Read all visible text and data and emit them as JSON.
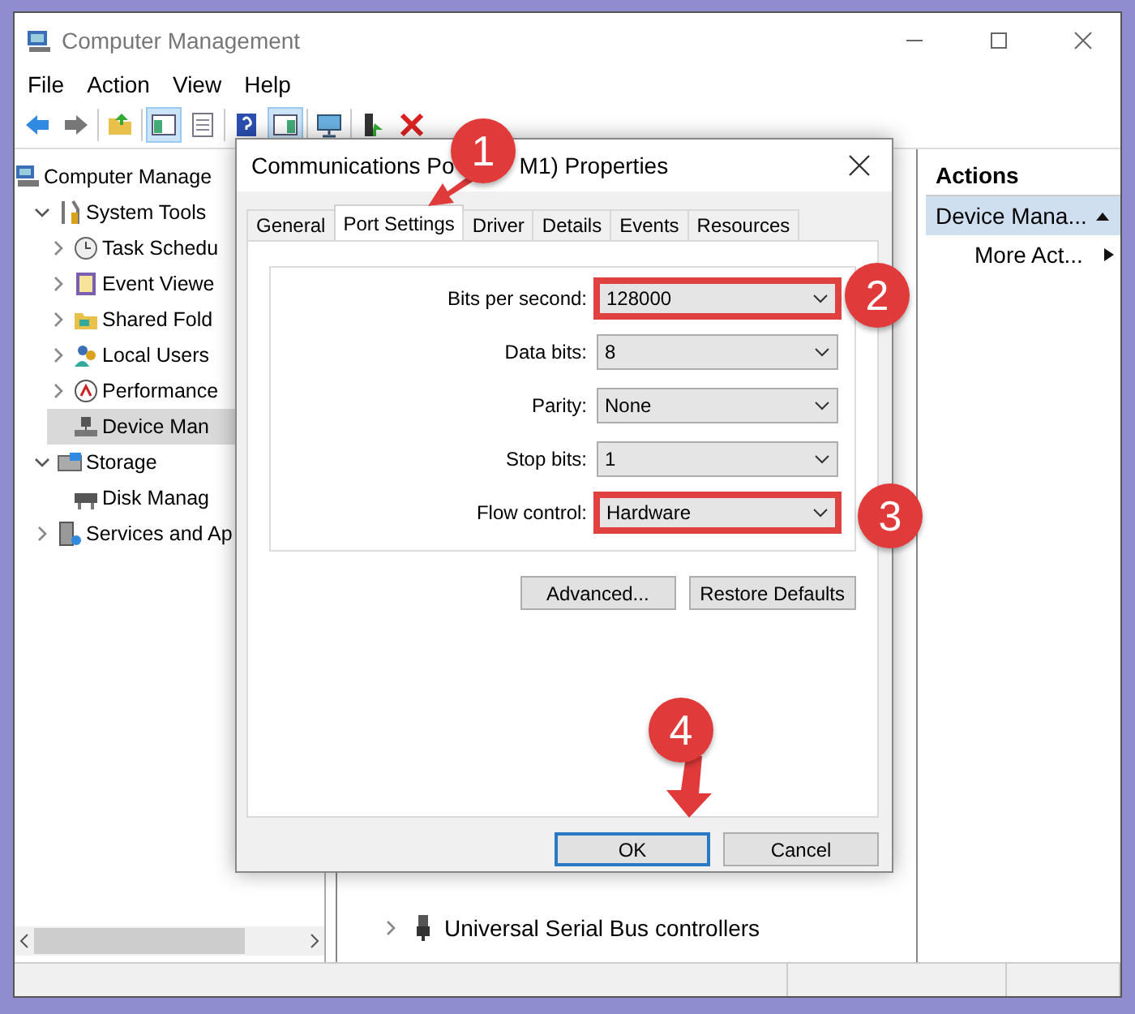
{
  "window": {
    "title": "Computer Management"
  },
  "menu": [
    "File",
    "Action",
    "View",
    "Help"
  ],
  "toolbar": [
    {
      "kind": "back",
      "pressed": false
    },
    {
      "kind": "forward",
      "pressed": false
    },
    {
      "kind": "folder",
      "pressed": false
    },
    {
      "kind": "pane",
      "pressed": true
    },
    {
      "kind": "list",
      "pressed": false
    },
    {
      "kind": "help",
      "pressed": false
    },
    {
      "kind": "pane2",
      "pressed": true
    },
    {
      "kind": "monitor",
      "pressed": false
    },
    {
      "kind": "user",
      "pressed": false
    },
    {
      "kind": "delete",
      "pressed": false
    }
  ],
  "tree": [
    {
      "label": "Computer Manage",
      "kind": "computer",
      "selected": false,
      "children": [
        {
          "label": "System Tools",
          "kind": "tools",
          "expanded": true,
          "selected": false,
          "children": [
            {
              "label": "Task Schedu",
              "kind": "clock",
              "expanded": false,
              "selected": false
            },
            {
              "label": "Event Viewe",
              "kind": "log",
              "expanded": false,
              "selected": false
            },
            {
              "label": "Shared Fold",
              "kind": "folder",
              "expanded": false,
              "selected": false
            },
            {
              "label": "Local Users",
              "kind": "users",
              "expanded": false,
              "selected": false
            },
            {
              "label": "Performance",
              "kind": "gauge",
              "expanded": false,
              "selected": false
            },
            {
              "label": "Device Man",
              "kind": "device",
              "selected": true
            }
          ]
        },
        {
          "label": "Storage",
          "kind": "storage",
          "expanded": true,
          "selected": false,
          "children": [
            {
              "label": "Disk Manag",
              "kind": "disk",
              "selected": false
            }
          ]
        },
        {
          "label": "Services and Ap",
          "kind": "services",
          "expanded": false,
          "selected": false
        }
      ]
    }
  ],
  "device_list": [
    {
      "label": "Universal Serial Bus controllers",
      "expanded": false
    }
  ],
  "actions": {
    "title": "Actions",
    "items": [
      {
        "label": "Device Mana...",
        "kind": "group"
      },
      {
        "label": "More Act...",
        "kind": "item"
      }
    ]
  },
  "dialog": {
    "title_parts": [
      "Communications Po",
      "M1) Properties"
    ],
    "tabs": [
      {
        "label": "General",
        "selected": false
      },
      {
        "label": "Port Settings",
        "selected": true
      },
      {
        "label": "Driver",
        "selected": false
      },
      {
        "label": "Details",
        "selected": false
      },
      {
        "label": "Events",
        "selected": false
      },
      {
        "label": "Resources",
        "selected": false
      }
    ],
    "fields": [
      {
        "label": "Bits per second:",
        "value": "128000",
        "highlighted": true
      },
      {
        "label": "Data bits:",
        "value": "8",
        "highlighted": false
      },
      {
        "label": "Parity:",
        "value": "None",
        "highlighted": false
      },
      {
        "label": "Stop bits:",
        "value": "1",
        "highlighted": false
      },
      {
        "label": "Flow control:",
        "value": "Hardware",
        "highlighted": true
      }
    ],
    "panel_buttons": [
      "Advanced...",
      "Restore Defaults"
    ],
    "buttons": [
      {
        "label": "OK",
        "default": true
      },
      {
        "label": "Cancel",
        "default": false
      }
    ]
  },
  "callouts": [
    {
      "label": "1"
    },
    {
      "label": "2"
    },
    {
      "label": "3"
    },
    {
      "label": "4"
    }
  ]
}
